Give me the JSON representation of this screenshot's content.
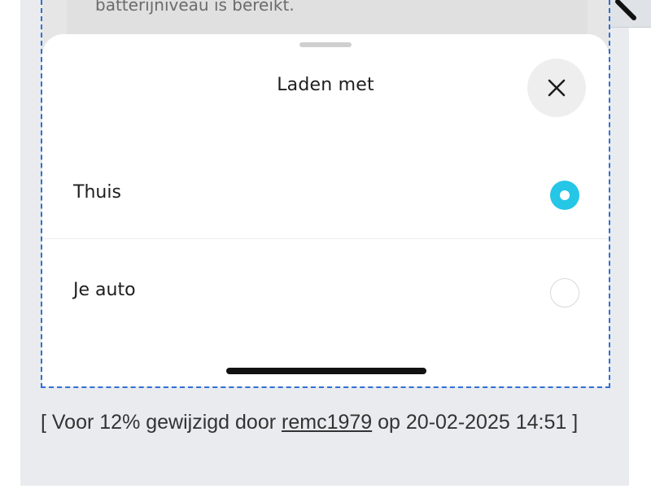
{
  "backdrop": {
    "text": "batterijniveau is bereikt."
  },
  "sheet": {
    "title": "Laden met",
    "options": [
      {
        "label": "Thuis",
        "selected": true
      },
      {
        "label": "Je auto",
        "selected": false
      }
    ],
    "accent_color": "#25c6e6"
  },
  "edit_note": {
    "prefix": "[ Voor 12% gewijzigd door ",
    "user": "remc1979",
    "suffix": " op 20-02-2025 14:51 ]"
  },
  "icons": {
    "close": "close-icon",
    "edit": "pencil-icon"
  }
}
